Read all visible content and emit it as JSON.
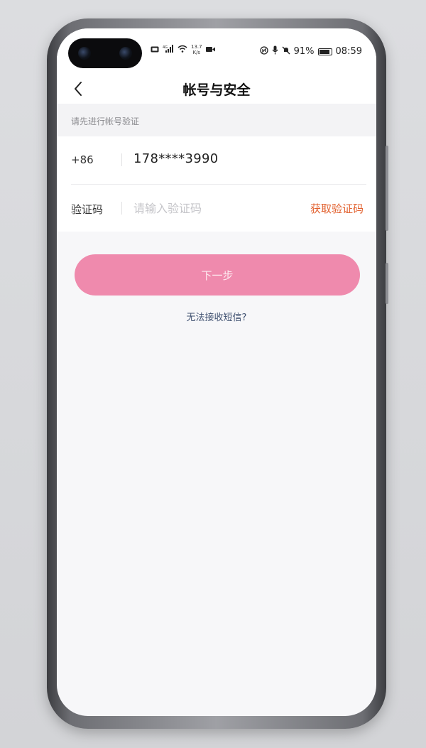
{
  "status_bar": {
    "net_speed_value": "13.7",
    "net_speed_unit": "K/s",
    "battery_percent": "91%",
    "time": "08:59"
  },
  "nav": {
    "title": "帐号与安全"
  },
  "hint": "请先进行帐号验证",
  "form": {
    "country_code": "+86",
    "phone_number": "178****3990",
    "code_label": "验证码",
    "code_value": "",
    "code_placeholder": "请输入验证码",
    "get_code_label": "获取验证码"
  },
  "next_button_label": "下一步",
  "help_link": "无法接收短信?",
  "colors": {
    "accent_pink": "#ef8aad",
    "link_orange": "#e2612f",
    "link_blue": "#3f5070"
  }
}
